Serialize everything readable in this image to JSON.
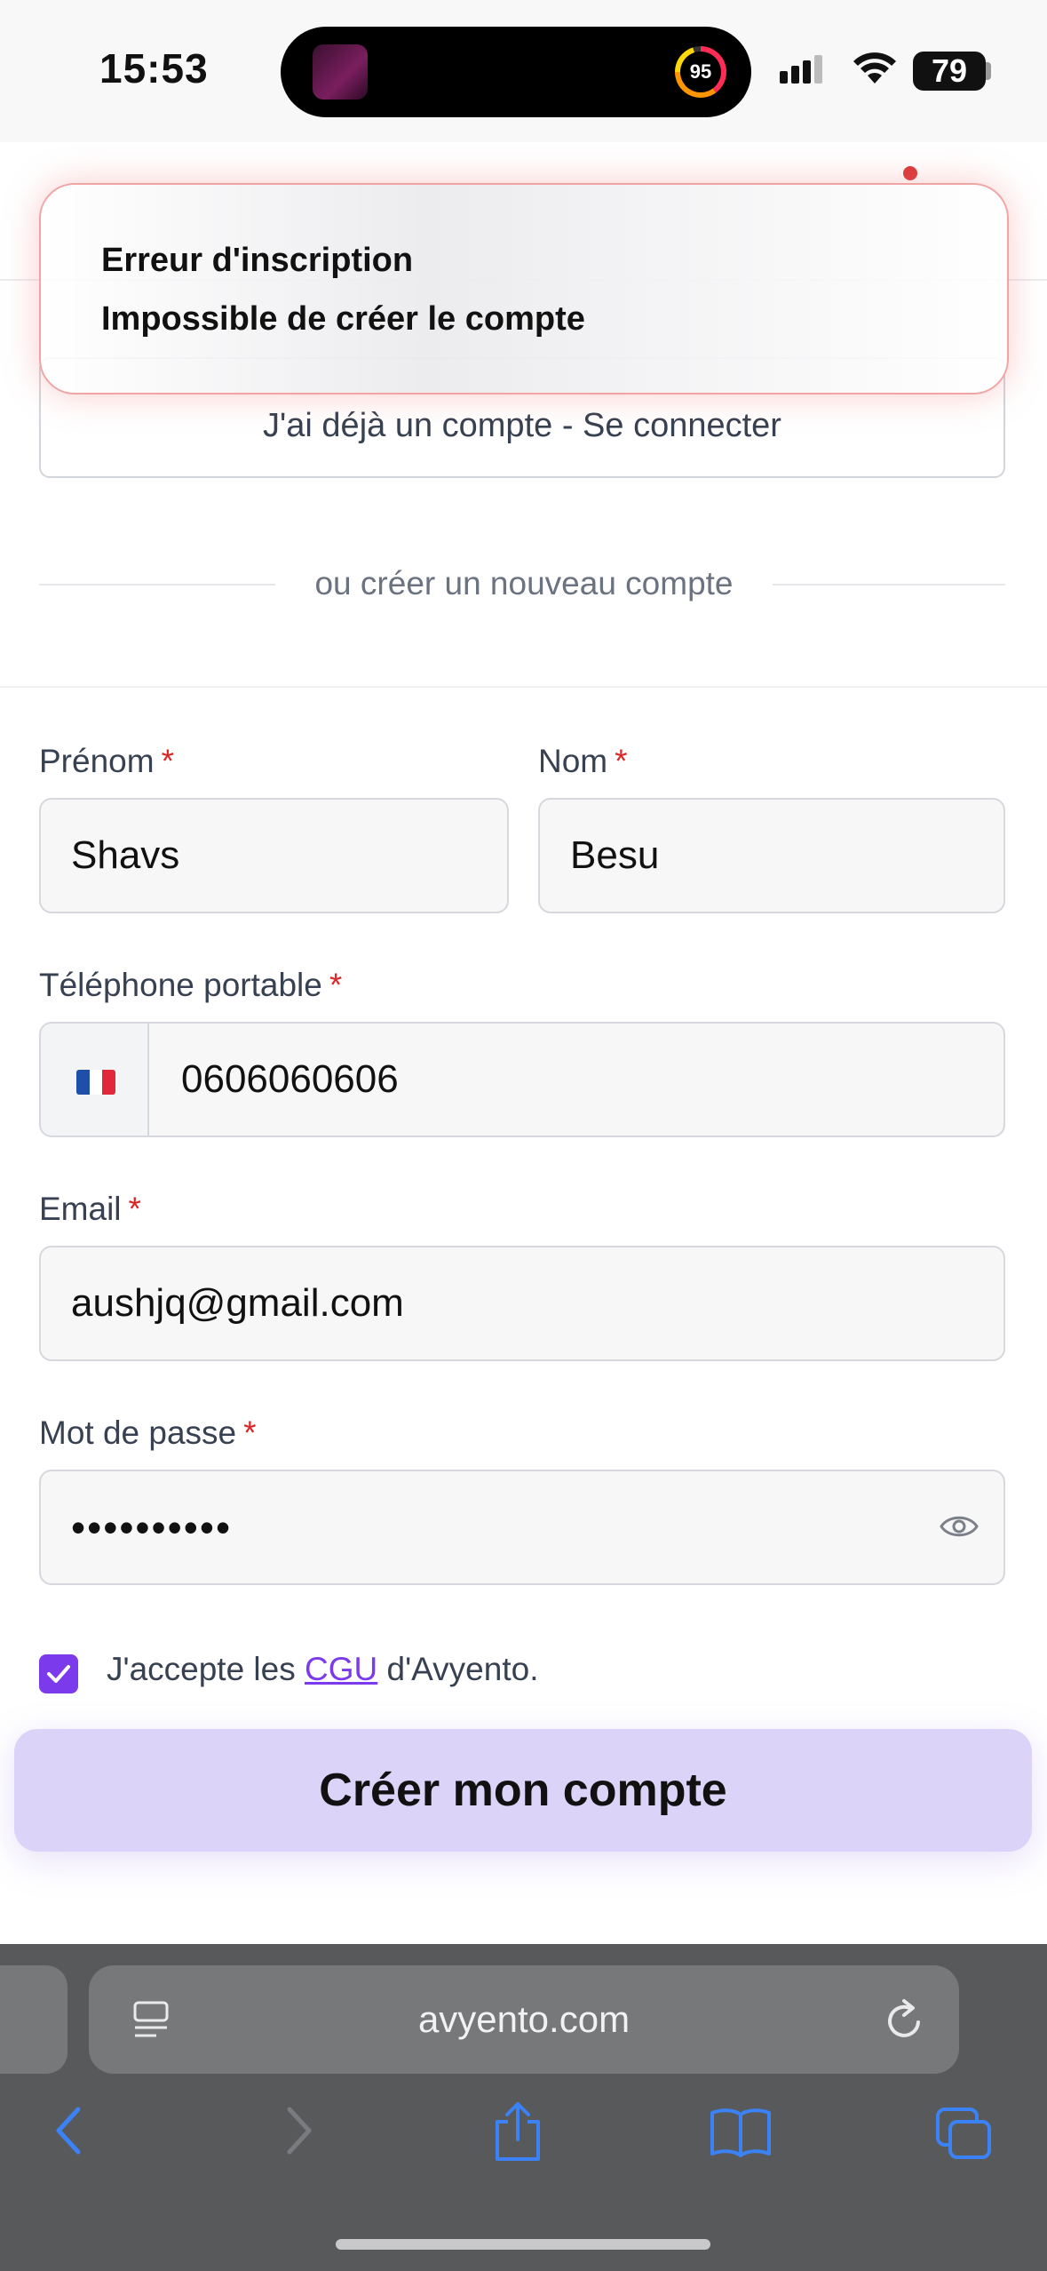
{
  "status_bar": {
    "time": "15:53",
    "activity_ring": "95",
    "battery": "79"
  },
  "toast": {
    "title": "Erreur d'inscription",
    "description": "Impossible de créer le compte"
  },
  "login_button": "J'ai déjà un compte - Se connecter",
  "divider_text": "ou créer un nouveau compte",
  "form": {
    "first_name": {
      "label": "Prénom",
      "required": "*",
      "value": "Shavs"
    },
    "last_name": {
      "label": "Nom",
      "required": "*",
      "value": "Besu"
    },
    "phone": {
      "label": "Téléphone portable",
      "required": "*",
      "value": "0606060606",
      "country_flag": "FR"
    },
    "email": {
      "label": "Email",
      "required": "*",
      "value": "aushjq@gmail.com"
    },
    "password": {
      "label": "Mot de passe",
      "required": "*",
      "value": "••••••••••"
    },
    "terms": {
      "checked": true,
      "prefix": "J'accepte les ",
      "link": "CGU",
      "suffix": " d'Avyento."
    },
    "submit_label": "Créer mon compte"
  },
  "browser": {
    "url": "avyento.com"
  },
  "colors": {
    "accent": "#7c3aed",
    "submit_bg": "#dcd3f8",
    "required": "#dc2626",
    "toast_border": "#f0a4a4"
  }
}
